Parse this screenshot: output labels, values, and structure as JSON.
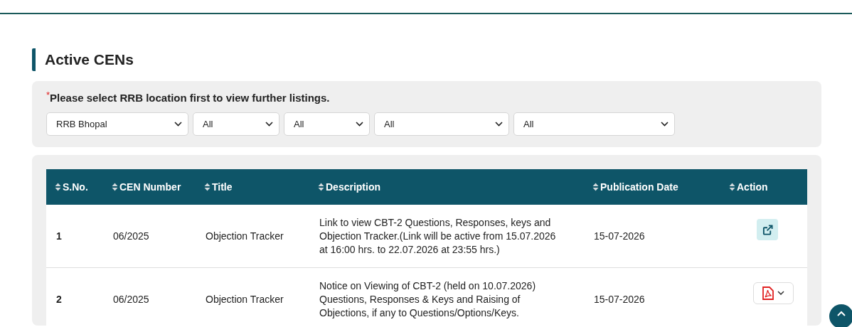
{
  "section": {
    "title": "Active CENs"
  },
  "filters": {
    "note": "Please select RRB location first to view further listings.",
    "required_mark": "*",
    "selects": [
      {
        "value": "RRB Bhopal"
      },
      {
        "value": "All"
      },
      {
        "value": "All"
      },
      {
        "value": "All"
      },
      {
        "value": "All"
      }
    ]
  },
  "table": {
    "columns": [
      "S.No.",
      "CEN Number",
      "Title",
      "Description",
      "Publication Date",
      "Action"
    ],
    "rows": [
      {
        "sno": "1",
        "cen": "06/2025",
        "title": "Objection Tracker",
        "description": "Link to view CBT-2 Questions, Responses, keys and Objection Tracker.(Link will be active from 15.07.2026 at 16:00 hrs. to 22.07.2026 at 23:55 hrs.)",
        "date": "15-07-2026",
        "action": {
          "kind": "link"
        }
      },
      {
        "sno": "2",
        "cen": "06/2025",
        "title": "Objection Tracker",
        "description": "Notice on Viewing of CBT-2 (held on 10.07.2026) Questions, Responses & Keys and Raising of Objections, if any to Questions/Options/Keys.",
        "date": "15-07-2026",
        "action": {
          "kind": "pdf"
        }
      }
    ]
  }
}
